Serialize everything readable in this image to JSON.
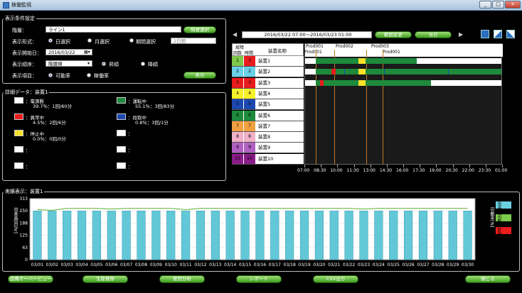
{
  "window": {
    "title": "稼働監視",
    "min": "_",
    "max": "□",
    "close": "×"
  },
  "display_settings": {
    "title": "表示条件設定",
    "hierarchy_label": "階層：",
    "hierarchy_value": "ライン1",
    "hierarchy_button": "階層選択",
    "format_label": "表示形式：",
    "format_options": [
      "日選択",
      "月選択",
      "期間選択"
    ],
    "period_value": "2日間",
    "start_label": "表示開始日：",
    "start_value": "2016/03/22",
    "order_label": "表示順序：",
    "order_value": "階層順",
    "order_dir": [
      "昇順",
      "降順"
    ],
    "item_label": "表示項目：",
    "item_options": [
      "可動率",
      "稼働率"
    ],
    "show_button": "表示"
  },
  "detail": {
    "title": "詳細データ：装置1",
    "items": [
      {
        "color": "#ffffff",
        "name": "：電源断",
        "value": "39.7％：1回/60分"
      },
      {
        "color": "#1e8a3c",
        "name": "：運転中",
        "value": "55.1％：3回/83分"
      },
      {
        "color": "#e81c1c",
        "name": "：異常中",
        "value": "4.5％：2回/6分"
      },
      {
        "color": "#1c48b0",
        "name": "：段取中",
        "value": "0.8％：3回/1分"
      },
      {
        "color": "#f5e22a",
        "name": "：停止中",
        "value": "0.0％：0回/0分"
      },
      {
        "color": "#ffffff",
        "name": "：",
        "value": ""
      },
      {
        "color": "#ffffff",
        "name": "：",
        "value": ""
      },
      {
        "color": "#ffffff",
        "name": "：",
        "value": ""
      },
      {
        "color": "#ffffff",
        "name": "：",
        "value": ""
      },
      {
        "color": "#ffffff",
        "name": "：",
        "value": ""
      }
    ]
  },
  "timeline": {
    "range": "2016/03/22 07:00～2016/03/23 01:00",
    "range_button": "範囲変更",
    "today_button": "当日",
    "prev": "◀",
    "next": "▶",
    "head_fault": "故障",
    "head_count": "回数",
    "head_time": "時間",
    "head_name": "装置名称",
    "products": [
      "Prod001",
      "Prod001",
      "Prod002",
      "Prod003",
      "Prod001"
    ],
    "devices": [
      {
        "count": "1",
        "time": "3",
        "name": "装置1",
        "c1": "#7dc94a",
        "c2": "#e81c1c"
      },
      {
        "count": "2",
        "time": "2",
        "name": "装置2",
        "c1": "#6ad0e8",
        "c2": "#6ad0e8"
      },
      {
        "count": "3",
        "time": "3",
        "name": "装置3",
        "c1": "#e81c1c",
        "c2": "#e81c1c"
      },
      {
        "count": "4",
        "time": "4",
        "name": "装置4",
        "c1": "#f5f02a",
        "c2": "#f5f02a"
      },
      {
        "count": "5",
        "time": "5",
        "name": "装置5",
        "c1": "#1c48b0",
        "c2": "#1c48b0"
      },
      {
        "count": "6",
        "time": "6",
        "name": "装置6",
        "c1": "#1e8a3c",
        "c2": "#1e8a3c"
      },
      {
        "count": "7",
        "time": "7",
        "name": "装置7",
        "c1": "#f0a040",
        "c2": "#f0a040"
      },
      {
        "count": "8",
        "time": "8",
        "name": "装置8",
        "c1": "#f0b0c8",
        "c2": "#f0b0c8"
      },
      {
        "count": "9",
        "time": "9",
        "name": "装置9",
        "c1": "#b060c0",
        "c2": "#b060c0"
      },
      {
        "count": "10",
        "time": "10",
        "name": "装置10",
        "c1": "#8a1c8a",
        "c2": "#8a1c8a"
      }
    ],
    "ticks": [
      "07:00",
      "08:30",
      "10:00",
      "11:30",
      "13:00",
      "14:30",
      "16:00",
      "17:30",
      "19:00",
      "20:30",
      "22:00",
      "23:30",
      "01:00"
    ]
  },
  "trend": {
    "title": "実績表示：装置1",
    "left_axis_label": "出来高[回/hr]",
    "right_axis_label": "可動率[%]",
    "left_ticks": [
      "313",
      "250",
      "188",
      "125",
      "63",
      "0"
    ],
    "right_ticks": [
      "100",
      "80",
      "60",
      "40",
      "20",
      "0"
    ],
    "legend": [
      "出来高",
      "可動率",
      "計画値"
    ],
    "legend_colors": [
      "#6ad0e0",
      "#7dc94a",
      "#e81c1c"
    ]
  },
  "chart_data": {
    "type": "bar",
    "categories": [
      "03/01",
      "03/02",
      "03/03",
      "03/04",
      "03/05",
      "03/06",
      "03/07",
      "03/08",
      "03/09",
      "03/10",
      "03/11",
      "03/12",
      "03/13",
      "03/14",
      "03/15",
      "03/16",
      "03/17",
      "03/18",
      "03/19",
      "03/20",
      "03/21",
      "03/22",
      "03/23",
      "03/24",
      "03/25",
      "03/26",
      "03/27",
      "03/28",
      "03/29",
      "03/30"
    ],
    "series": [
      {
        "name": "出来高",
        "values": [
          250,
          250,
          250,
          250,
          250,
          250,
          250,
          250,
          250,
          250,
          250,
          250,
          250,
          250,
          250,
          250,
          250,
          250,
          250,
          250,
          250,
          250,
          250,
          250,
          250,
          250,
          250,
          250,
          250,
          250
        ]
      },
      {
        "name": "可動率",
        "values": [
          82,
          81,
          84,
          84,
          84,
          83,
          84,
          84,
          84,
          84,
          82,
          84,
          84,
          84,
          84,
          84,
          84,
          84,
          84,
          84,
          84,
          84,
          83,
          84,
          84,
          84,
          84,
          84,
          84,
          84
        ]
      }
    ],
    "ylim": [
      0,
      313
    ],
    "y2lim": [
      0,
      100
    ]
  },
  "footer": {
    "buttons": [
      "設備オーバービュー",
      "生産推移",
      "要因分析",
      "レポート",
      "CSV出力",
      "閉じる"
    ]
  }
}
